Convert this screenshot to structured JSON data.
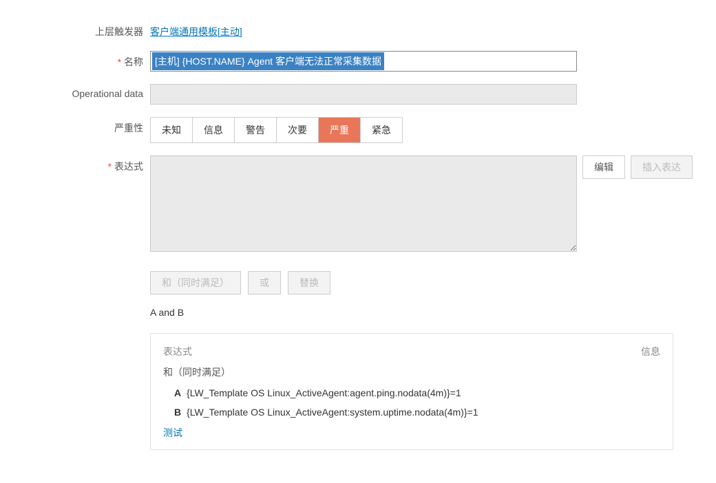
{
  "labels": {
    "parent_trigger": "上层触发器",
    "name": "名称",
    "operational_data": "Operational data",
    "severity": "严重性",
    "expression": "表达式"
  },
  "parent_trigger_link": "客户端通用模板[主动]",
  "name_value": "[主机] {HOST.NAME} Agent 客户端无法正常采集数据",
  "operational_data_value": "",
  "severity_options": [
    "未知",
    "信息",
    "警告",
    "次要",
    "严重",
    "紧急"
  ],
  "severity_selected_index": 4,
  "expression_value": "",
  "buttons": {
    "edit": "编辑",
    "insert": "插入表达",
    "and": "和（同时满足）",
    "or": "或",
    "replace": "替换"
  },
  "summary": "A and B",
  "panel": {
    "header_left": "表达式",
    "header_right": "信息",
    "and_label": "和（同时满足）",
    "items": [
      {
        "tag": "A",
        "text": "{LW_Template OS Linux_ActiveAgent:agent.ping.nodata(4m)}=1"
      },
      {
        "tag": "B",
        "text": "{LW_Template OS Linux_ActiveAgent:system.uptime.nodata(4m)}=1"
      }
    ],
    "test": "测试"
  }
}
